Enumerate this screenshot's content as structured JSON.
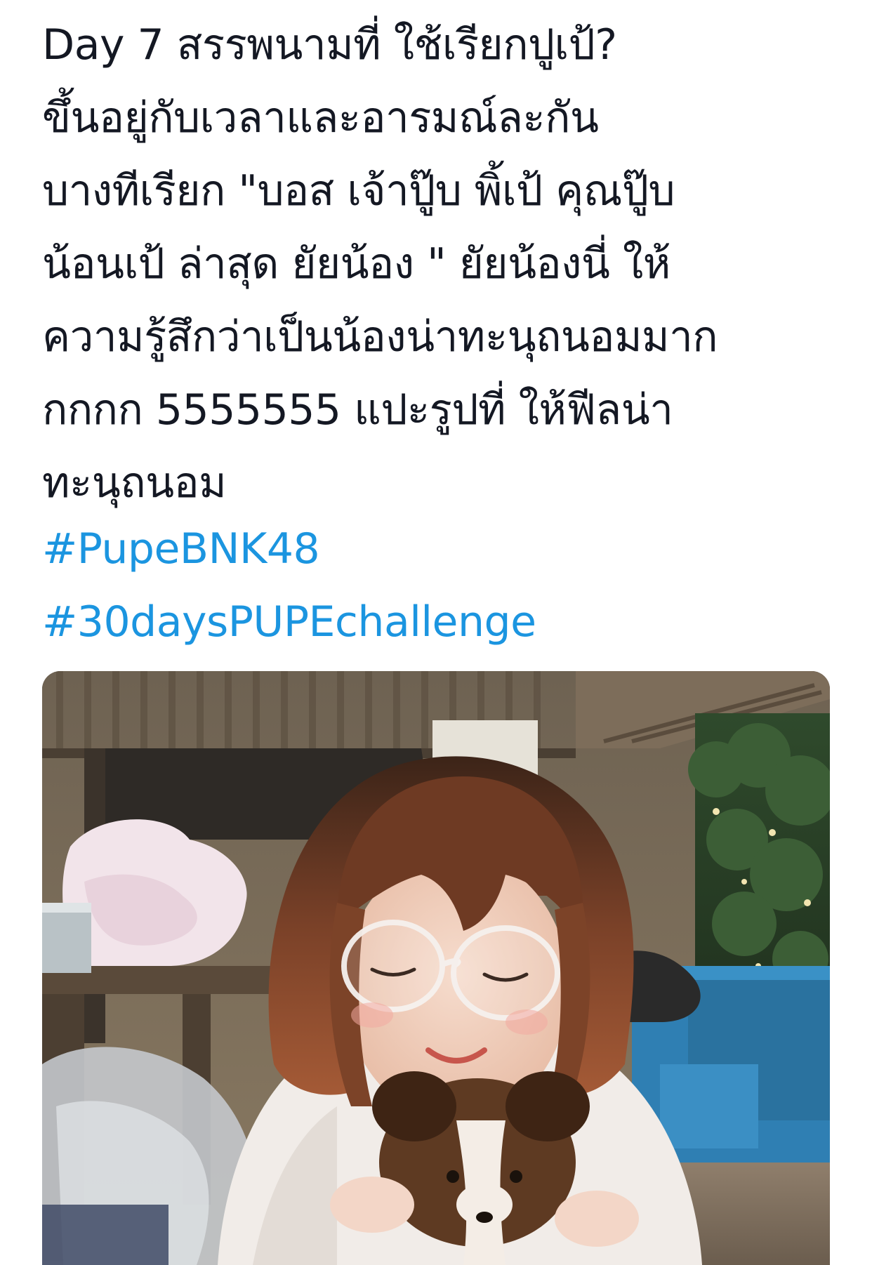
{
  "tweet": {
    "lines": [
      "Day 7 สรรพนามที่ ใช้เรียกปูเป้?",
      "ขึ้นอยู่กับเวลาและอารมณ์ละกัน",
      "บางทีเรียก \"บอส เจ้าปู๊บ พิ้เป้ คุณปู๊บ",
      "น้อนเป้ ล่าสุด ยัยน้อง \" ยัยน้องนี่ ให้",
      "ความรู้สึกว่าเป็นน้องน่าทะนุถนอมมาก",
      "กกกก 5555555 แปะรูปที่ ให้ฟีลน่า",
      "ทะนุถนอม"
    ],
    "hashtags": [
      "#PupeBNK48",
      "#30daysPUPEchallenge"
    ],
    "hashtag_color": "#1b95e0",
    "text_color": "#141823"
  }
}
